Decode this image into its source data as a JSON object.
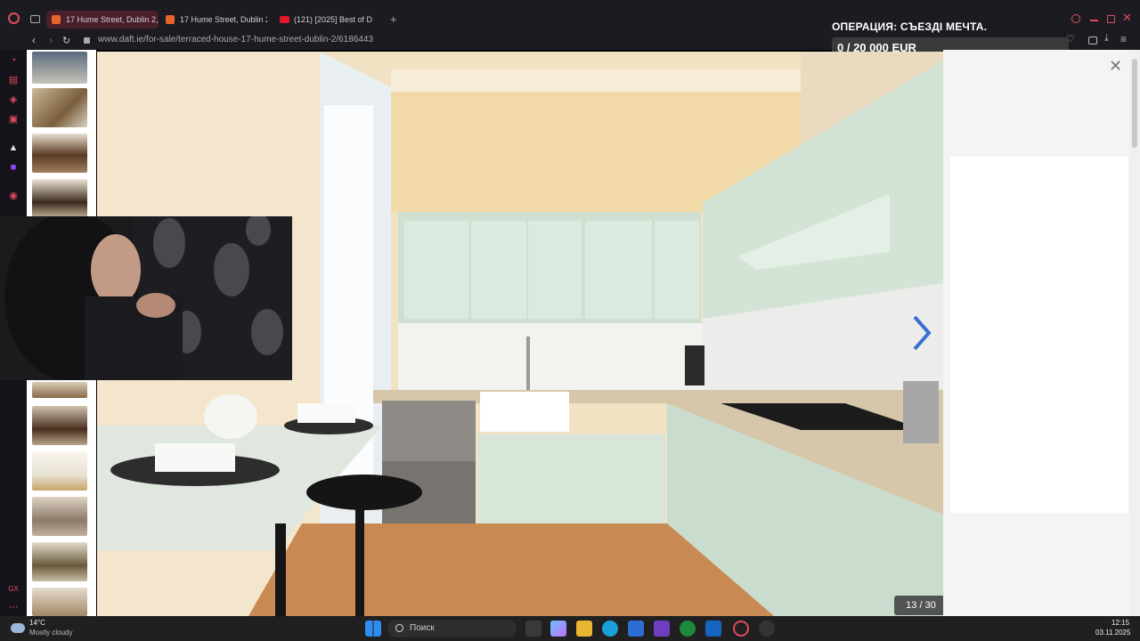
{
  "browser": {
    "tabs": [
      {
        "label": "17 Hume Street, Dublin 2,",
        "active": true
      },
      {
        "label": "17 Hume Street, Dublin 2,",
        "active": false
      },
      {
        "label": "(121) [2025] Best of D",
        "active": false
      }
    ],
    "url": "www.daft.ie/for-sale/terraced-house-17-hume-street-dublin-2/6186443"
  },
  "overlay": {
    "title": "ОПЕРАЦИЯ: СЪЕЗДІ МЕЧТА.",
    "progress_text": "0 / 20 000 EUR",
    "progress_fraction": 0
  },
  "gallery": {
    "counter": "13 / 30",
    "thumbnail_count": 12
  },
  "taskbar": {
    "weather_temp": "14°C",
    "weather_desc": "Mostly cloudy",
    "search_placeholder": "Поиск",
    "time": "12:15",
    "date": "03.11.2025"
  },
  "colors": {
    "accent_red": "#e04a5f",
    "arrow_blue": "#3b6fd4"
  }
}
